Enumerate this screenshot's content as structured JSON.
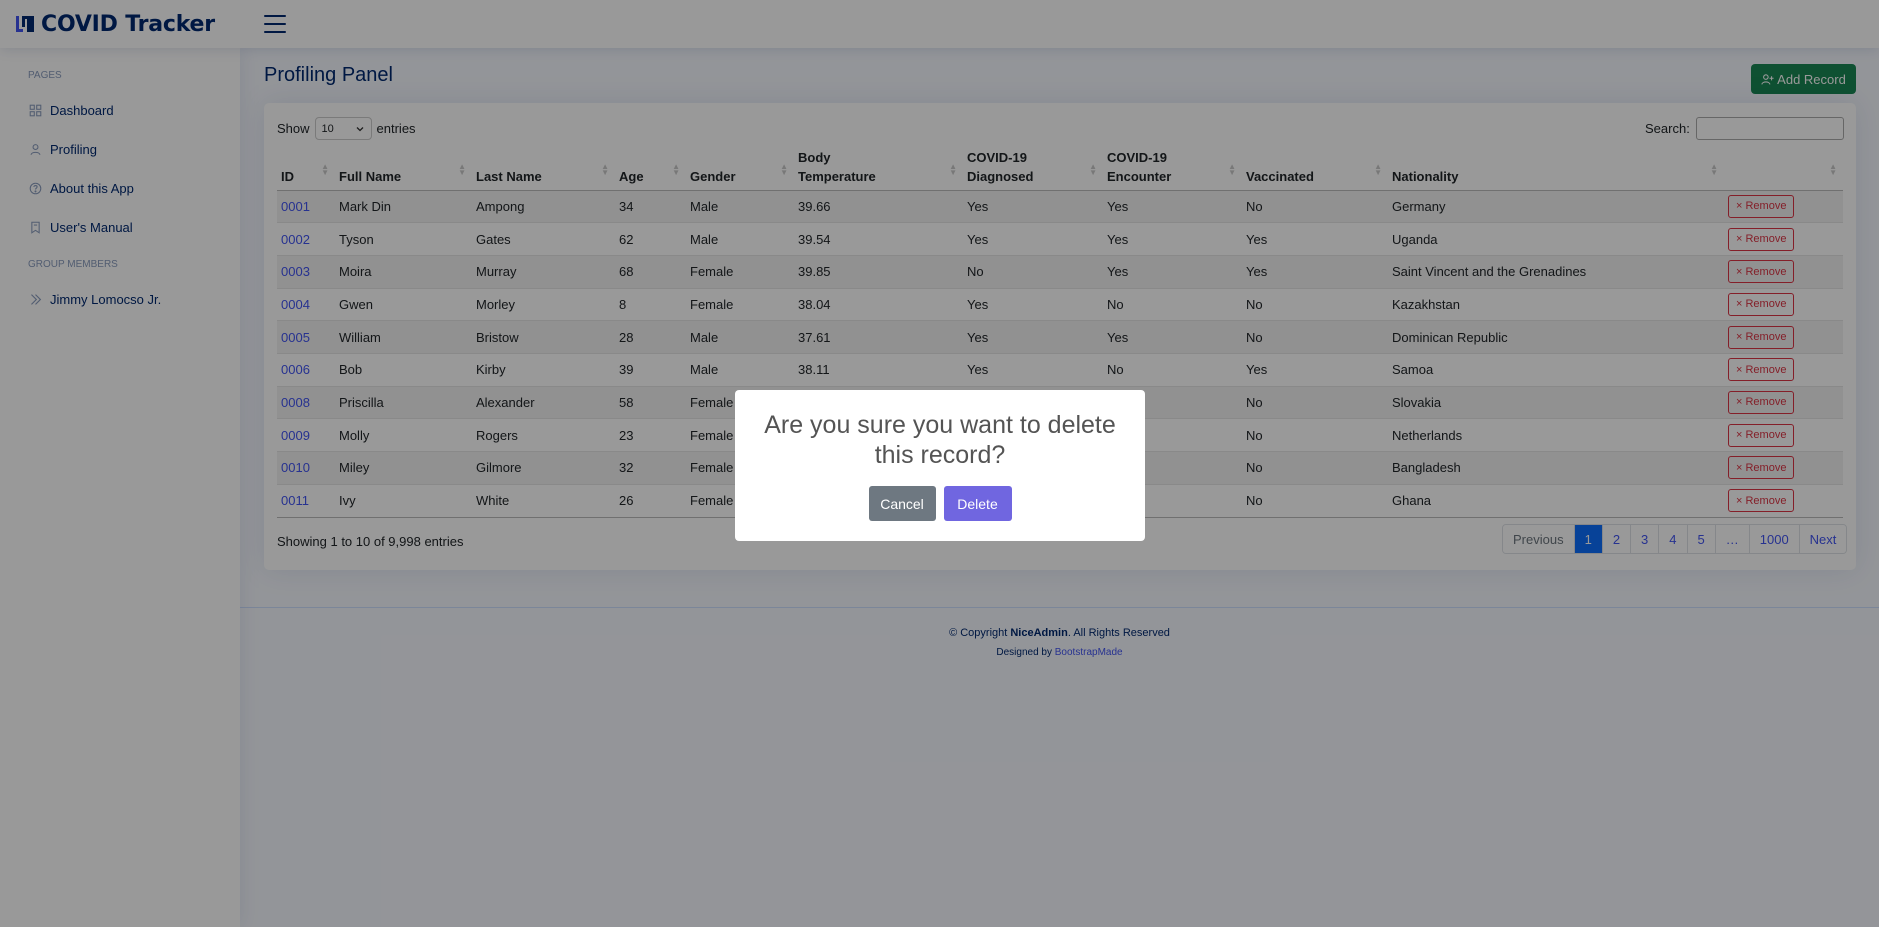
{
  "app": {
    "title": "COVID Tracker"
  },
  "sidebar": {
    "pages_heading": "PAGES",
    "items": [
      {
        "label": "Dashboard",
        "icon": "grid-icon"
      },
      {
        "label": "Profiling",
        "icon": "person-icon"
      },
      {
        "label": "About this App",
        "icon": "question-circle-icon"
      },
      {
        "label": "User's Manual",
        "icon": "bookmark-icon"
      }
    ],
    "group_heading": "GROUP MEMBERS",
    "members": [
      {
        "label": "Jimmy Lomocso Jr.",
        "icon": "chevron-double-right-icon"
      }
    ]
  },
  "main": {
    "title": "Profiling Panel",
    "add_button": "Add Record",
    "show_label": "Show",
    "entries_label": "entries",
    "page_length": "10",
    "search_label": "Search:",
    "search_value": "",
    "columns": [
      "ID",
      "Full Name",
      "Last Name",
      "Age",
      "Gender",
      "Body Temperature",
      "COVID-19 Diagnosed",
      "COVID-19 Encounter",
      "Vaccinated",
      "Nationality",
      ""
    ],
    "remove_label": "× Remove",
    "rows": [
      {
        "id": "0001",
        "first": "Mark Din",
        "last": "Ampong",
        "age": "34",
        "gender": "Male",
        "temp": "39.66",
        "diagnosed": "Yes",
        "encounter": "Yes",
        "vaccinated": "No",
        "nationality": "Germany"
      },
      {
        "id": "0002",
        "first": "Tyson",
        "last": "Gates",
        "age": "62",
        "gender": "Male",
        "temp": "39.54",
        "diagnosed": "Yes",
        "encounter": "Yes",
        "vaccinated": "Yes",
        "nationality": "Uganda"
      },
      {
        "id": "0003",
        "first": "Moira",
        "last": "Murray",
        "age": "68",
        "gender": "Female",
        "temp": "39.85",
        "diagnosed": "No",
        "encounter": "Yes",
        "vaccinated": "Yes",
        "nationality": "Saint Vincent and the Grenadines"
      },
      {
        "id": "0004",
        "first": "Gwen",
        "last": "Morley",
        "age": "8",
        "gender": "Female",
        "temp": "38.04",
        "diagnosed": "Yes",
        "encounter": "No",
        "vaccinated": "No",
        "nationality": "Kazakhstan"
      },
      {
        "id": "0005",
        "first": "William",
        "last": "Bristow",
        "age": "28",
        "gender": "Male",
        "temp": "37.61",
        "diagnosed": "Yes",
        "encounter": "Yes",
        "vaccinated": "No",
        "nationality": "Dominican Republic"
      },
      {
        "id": "0006",
        "first": "Bob",
        "last": "Kirby",
        "age": "39",
        "gender": "Male",
        "temp": "38.11",
        "diagnosed": "Yes",
        "encounter": "No",
        "vaccinated": "Yes",
        "nationality": "Samoa"
      },
      {
        "id": "0008",
        "first": "Priscilla",
        "last": "Alexander",
        "age": "58",
        "gender": "Female",
        "temp": "",
        "diagnosed": "",
        "encounter": "",
        "vaccinated": "No",
        "nationality": "Slovakia"
      },
      {
        "id": "0009",
        "first": "Molly",
        "last": "Rogers",
        "age": "23",
        "gender": "Female",
        "temp": "",
        "diagnosed": "",
        "encounter": "",
        "vaccinated": "No",
        "nationality": "Netherlands"
      },
      {
        "id": "0010",
        "first": "Miley",
        "last": "Gilmore",
        "age": "32",
        "gender": "Female",
        "temp": "",
        "diagnosed": "",
        "encounter": "",
        "vaccinated": "No",
        "nationality": "Bangladesh"
      },
      {
        "id": "0011",
        "first": "Ivy",
        "last": "White",
        "age": "26",
        "gender": "Female",
        "temp": "",
        "diagnosed": "",
        "encounter": "",
        "vaccinated": "No",
        "nationality": "Ghana"
      }
    ],
    "info": "Showing 1 to 10 of 9,998 entries",
    "pagination": [
      "Previous",
      "1",
      "2",
      "3",
      "4",
      "5",
      "…",
      "1000",
      "Next"
    ],
    "active_page": "1"
  },
  "footer": {
    "copyright_prefix": "© Copyright ",
    "brand": "NiceAdmin",
    "copyright_suffix": ". All Rights Reserved",
    "designed_by": "Designed by ",
    "designer": "BootstrapMade"
  },
  "modal": {
    "title": "Are you sure you want to delete this record?",
    "cancel": "Cancel",
    "delete": "Delete"
  },
  "colors": {
    "brand": "#012970",
    "accent": "#4154f1",
    "danger": "#dc3545",
    "success": "#198754",
    "modal_confirm": "#7066e0",
    "modal_cancel": "#6e7881"
  }
}
